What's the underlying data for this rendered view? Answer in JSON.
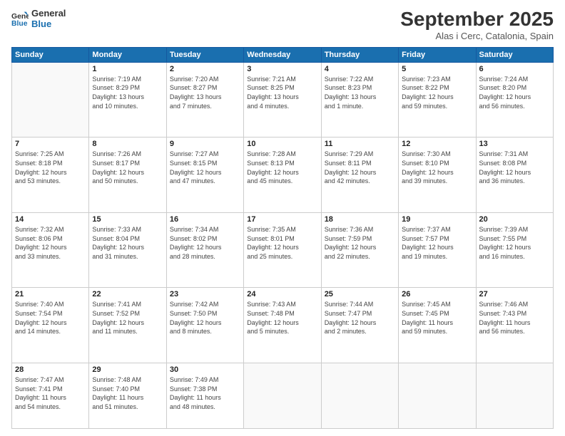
{
  "header": {
    "logo_line1": "General",
    "logo_line2": "Blue",
    "month": "September 2025",
    "location": "Alas i Cerc, Catalonia, Spain"
  },
  "weekdays": [
    "Sunday",
    "Monday",
    "Tuesday",
    "Wednesday",
    "Thursday",
    "Friday",
    "Saturday"
  ],
  "weeks": [
    [
      {
        "day": "",
        "info": ""
      },
      {
        "day": "1",
        "info": "Sunrise: 7:19 AM\nSunset: 8:29 PM\nDaylight: 13 hours\nand 10 minutes."
      },
      {
        "day": "2",
        "info": "Sunrise: 7:20 AM\nSunset: 8:27 PM\nDaylight: 13 hours\nand 7 minutes."
      },
      {
        "day": "3",
        "info": "Sunrise: 7:21 AM\nSunset: 8:25 PM\nDaylight: 13 hours\nand 4 minutes."
      },
      {
        "day": "4",
        "info": "Sunrise: 7:22 AM\nSunset: 8:23 PM\nDaylight: 13 hours\nand 1 minute."
      },
      {
        "day": "5",
        "info": "Sunrise: 7:23 AM\nSunset: 8:22 PM\nDaylight: 12 hours\nand 59 minutes."
      },
      {
        "day": "6",
        "info": "Sunrise: 7:24 AM\nSunset: 8:20 PM\nDaylight: 12 hours\nand 56 minutes."
      }
    ],
    [
      {
        "day": "7",
        "info": "Sunrise: 7:25 AM\nSunset: 8:18 PM\nDaylight: 12 hours\nand 53 minutes."
      },
      {
        "day": "8",
        "info": "Sunrise: 7:26 AM\nSunset: 8:17 PM\nDaylight: 12 hours\nand 50 minutes."
      },
      {
        "day": "9",
        "info": "Sunrise: 7:27 AM\nSunset: 8:15 PM\nDaylight: 12 hours\nand 47 minutes."
      },
      {
        "day": "10",
        "info": "Sunrise: 7:28 AM\nSunset: 8:13 PM\nDaylight: 12 hours\nand 45 minutes."
      },
      {
        "day": "11",
        "info": "Sunrise: 7:29 AM\nSunset: 8:11 PM\nDaylight: 12 hours\nand 42 minutes."
      },
      {
        "day": "12",
        "info": "Sunrise: 7:30 AM\nSunset: 8:10 PM\nDaylight: 12 hours\nand 39 minutes."
      },
      {
        "day": "13",
        "info": "Sunrise: 7:31 AM\nSunset: 8:08 PM\nDaylight: 12 hours\nand 36 minutes."
      }
    ],
    [
      {
        "day": "14",
        "info": "Sunrise: 7:32 AM\nSunset: 8:06 PM\nDaylight: 12 hours\nand 33 minutes."
      },
      {
        "day": "15",
        "info": "Sunrise: 7:33 AM\nSunset: 8:04 PM\nDaylight: 12 hours\nand 31 minutes."
      },
      {
        "day": "16",
        "info": "Sunrise: 7:34 AM\nSunset: 8:02 PM\nDaylight: 12 hours\nand 28 minutes."
      },
      {
        "day": "17",
        "info": "Sunrise: 7:35 AM\nSunset: 8:01 PM\nDaylight: 12 hours\nand 25 minutes."
      },
      {
        "day": "18",
        "info": "Sunrise: 7:36 AM\nSunset: 7:59 PM\nDaylight: 12 hours\nand 22 minutes."
      },
      {
        "day": "19",
        "info": "Sunrise: 7:37 AM\nSunset: 7:57 PM\nDaylight: 12 hours\nand 19 minutes."
      },
      {
        "day": "20",
        "info": "Sunrise: 7:39 AM\nSunset: 7:55 PM\nDaylight: 12 hours\nand 16 minutes."
      }
    ],
    [
      {
        "day": "21",
        "info": "Sunrise: 7:40 AM\nSunset: 7:54 PM\nDaylight: 12 hours\nand 14 minutes."
      },
      {
        "day": "22",
        "info": "Sunrise: 7:41 AM\nSunset: 7:52 PM\nDaylight: 12 hours\nand 11 minutes."
      },
      {
        "day": "23",
        "info": "Sunrise: 7:42 AM\nSunset: 7:50 PM\nDaylight: 12 hours\nand 8 minutes."
      },
      {
        "day": "24",
        "info": "Sunrise: 7:43 AM\nSunset: 7:48 PM\nDaylight: 12 hours\nand 5 minutes."
      },
      {
        "day": "25",
        "info": "Sunrise: 7:44 AM\nSunset: 7:47 PM\nDaylight: 12 hours\nand 2 minutes."
      },
      {
        "day": "26",
        "info": "Sunrise: 7:45 AM\nSunset: 7:45 PM\nDaylight: 11 hours\nand 59 minutes."
      },
      {
        "day": "27",
        "info": "Sunrise: 7:46 AM\nSunset: 7:43 PM\nDaylight: 11 hours\nand 56 minutes."
      }
    ],
    [
      {
        "day": "28",
        "info": "Sunrise: 7:47 AM\nSunset: 7:41 PM\nDaylight: 11 hours\nand 54 minutes."
      },
      {
        "day": "29",
        "info": "Sunrise: 7:48 AM\nSunset: 7:40 PM\nDaylight: 11 hours\nand 51 minutes."
      },
      {
        "day": "30",
        "info": "Sunrise: 7:49 AM\nSunset: 7:38 PM\nDaylight: 11 hours\nand 48 minutes."
      },
      {
        "day": "",
        "info": ""
      },
      {
        "day": "",
        "info": ""
      },
      {
        "day": "",
        "info": ""
      },
      {
        "day": "",
        "info": ""
      }
    ]
  ]
}
